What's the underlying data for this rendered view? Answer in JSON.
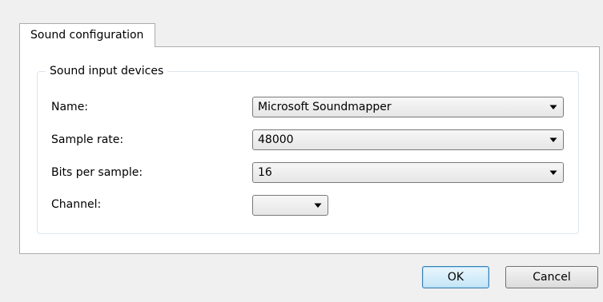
{
  "tabs": [
    {
      "label": "Sound configuration",
      "selected": true
    }
  ],
  "group": {
    "title": "Sound input devices",
    "fields": {
      "name": {
        "label": "Name:",
        "value": "Microsoft Soundmapper"
      },
      "sample_rate": {
        "label": "Sample rate:",
        "value": "48000"
      },
      "bits_per_sample": {
        "label": "Bits per sample:",
        "value": "16"
      },
      "channel": {
        "label": "Channel:",
        "value": ""
      }
    }
  },
  "buttons": {
    "ok": "OK",
    "cancel": "Cancel"
  },
  "icons": {
    "dropdown": "chevron-down-icon"
  },
  "colors": {
    "window_bg": "#f0f0f0",
    "panel_bg": "#ffffff",
    "default_button_border": "#3c7fb1"
  }
}
